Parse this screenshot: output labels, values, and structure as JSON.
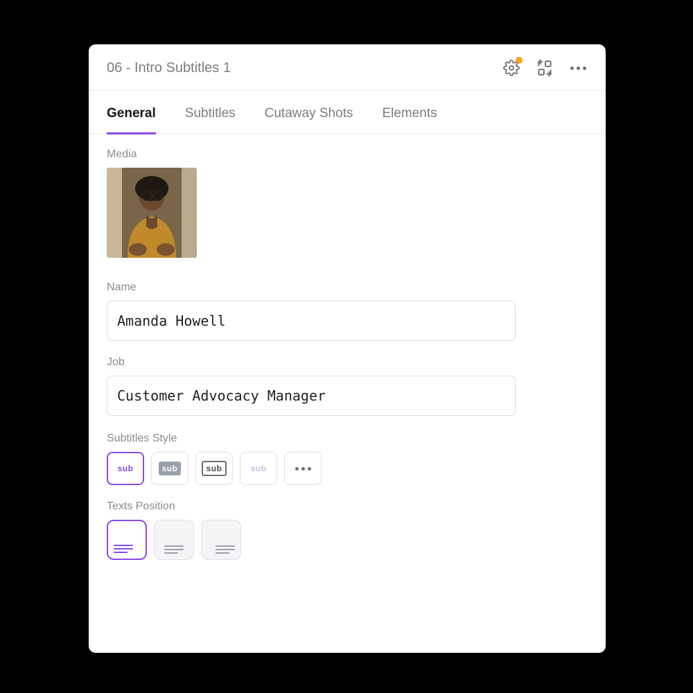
{
  "header": {
    "title": "06 - Intro Subtitles 1",
    "settings_has_notification": true
  },
  "tabs": [
    {
      "label": "General",
      "active": true
    },
    {
      "label": "Subtitles",
      "active": false
    },
    {
      "label": "Cutaway Shots",
      "active": false
    },
    {
      "label": "Elements",
      "active": false
    }
  ],
  "sections": {
    "media": {
      "label": "Media"
    },
    "name": {
      "label": "Name",
      "value": "Amanda Howell"
    },
    "job": {
      "label": "Job",
      "value": "Customer Advocacy Manager"
    },
    "subtitles_style": {
      "label": "Subtitles Style",
      "badge_text": "sub",
      "options": [
        "plain",
        "filled",
        "boxed",
        "fade",
        "more"
      ],
      "selected_index": 0
    },
    "texts_position": {
      "label": "Texts Position",
      "options": [
        "bottom-left",
        "bottom-center",
        "bottom-right"
      ],
      "selected_index": 0
    }
  }
}
